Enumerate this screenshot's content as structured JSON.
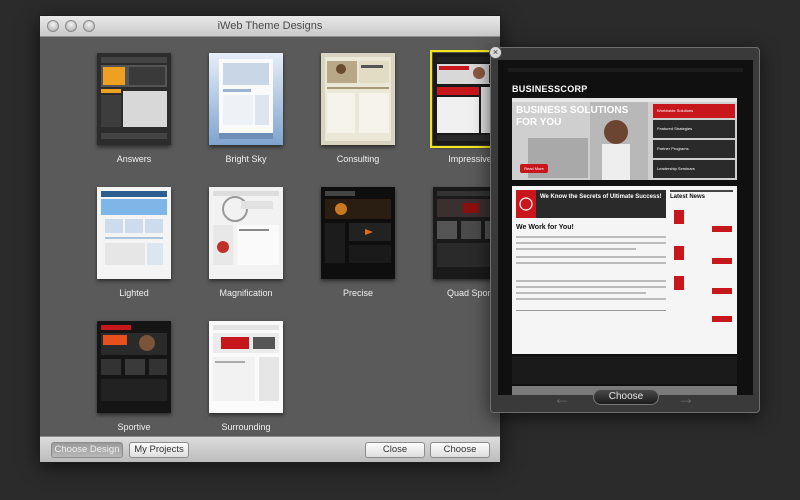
{
  "window": {
    "title": "iWeb Theme Designs"
  },
  "themes": [
    {
      "label": "Answers",
      "selected": false
    },
    {
      "label": "Bright Sky",
      "selected": false
    },
    {
      "label": "Consulting",
      "selected": false
    },
    {
      "label": "Impressive",
      "selected": true
    },
    {
      "label": "Lighted",
      "selected": false
    },
    {
      "label": "Magnification",
      "selected": false
    },
    {
      "label": "Precise",
      "selected": false
    },
    {
      "label": "Quad Sport",
      "selected": false
    },
    {
      "label": "Sportive",
      "selected": false
    },
    {
      "label": "Surrounding",
      "selected": false
    }
  ],
  "bottombar": {
    "choose_design": "Choose Design",
    "my_projects": "My Projects",
    "close": "Close",
    "choose": "Choose"
  },
  "preview": {
    "close_glyph": "×",
    "brand": "BUSINESSCORP",
    "hero_line1": "BUSINESS SOLUTIONS",
    "hero_line2": "FOR YOU",
    "hero_button": "Read More",
    "hero_menu": [
      "Worldwide Solutions",
      "Featured Strategies",
      "Partner Programs",
      "Leadership Seminars"
    ],
    "promo": "We Know the Secrets of Ultimate Success!",
    "section_title": "We Work for You!",
    "news_title": "Latest News",
    "choose": "Choose",
    "prev_glyph": "←",
    "next_glyph": "→"
  },
  "colors": {
    "selection": "#f2e51c",
    "accent": "#c8161d"
  }
}
